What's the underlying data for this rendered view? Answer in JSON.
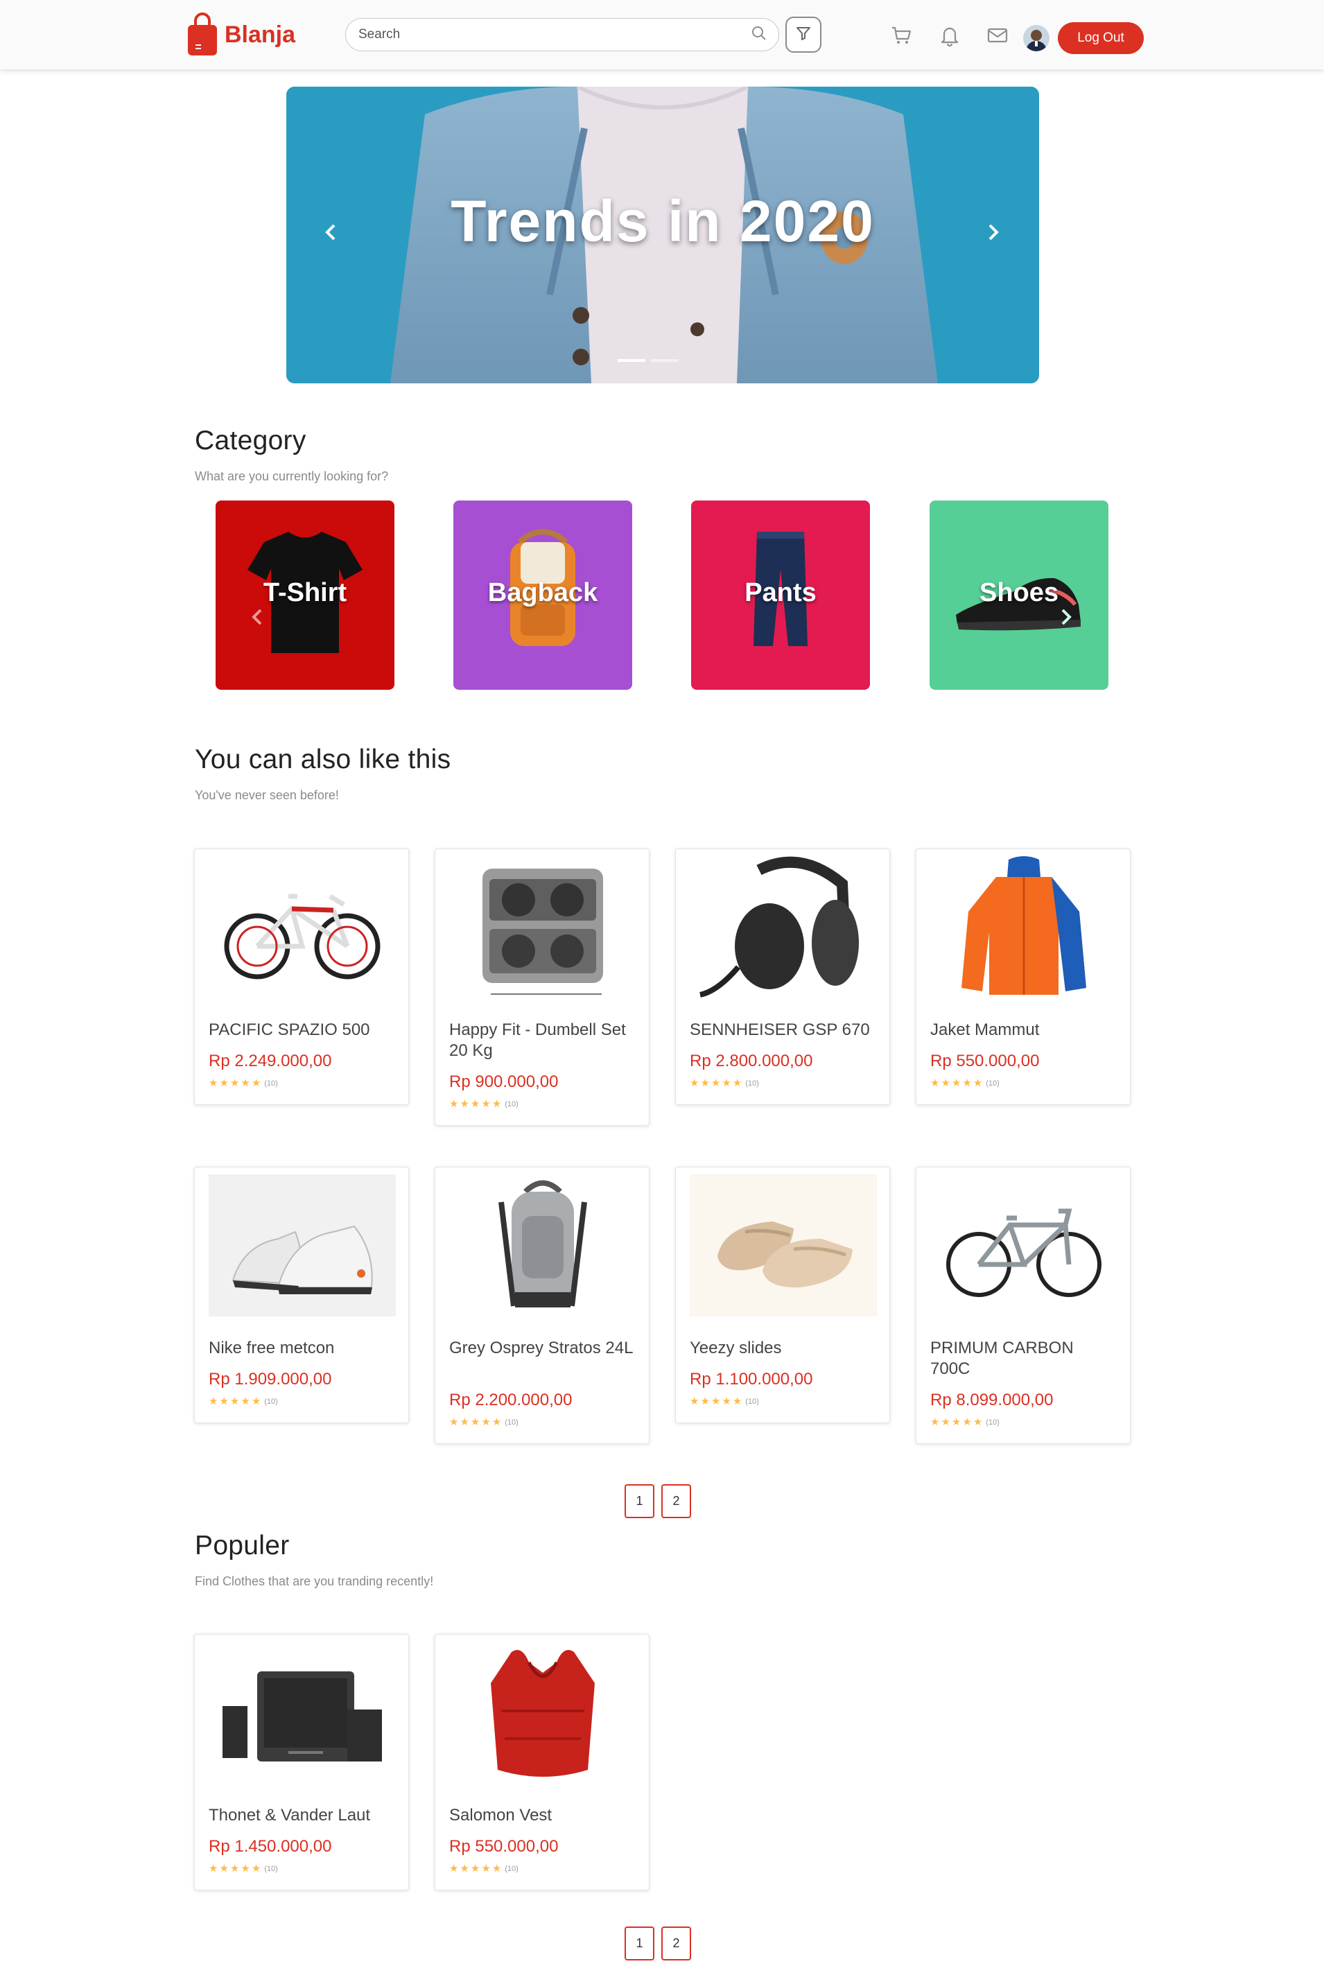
{
  "brand": {
    "name": "Blanja",
    "color": "#db3022"
  },
  "header": {
    "search_placeholder": "Search",
    "logout_label": "Log Out",
    "icons": [
      "search-icon",
      "filter-icon",
      "cart-icon",
      "bell-icon",
      "mail-icon"
    ]
  },
  "hero": {
    "title": "Trends in 2020",
    "slide_count": 2,
    "active_slide": 1
  },
  "category": {
    "title": "Category",
    "subtitle": "What are you currently looking for?",
    "items": [
      {
        "label": "T-Shirt",
        "color": "#cb0a0a"
      },
      {
        "label": "Bagback",
        "color": "#a64fd2"
      },
      {
        "label": "Pants",
        "color": "#e31b50"
      },
      {
        "label": "Shoes",
        "color": "#56cf96"
      }
    ]
  },
  "new": {
    "title": "You can also like this",
    "subtitle": "You've never seen before!",
    "products": [
      {
        "name": "PACIFIC SPAZIO 500",
        "price": "Rp 2.249.000,00",
        "reviews": "(10)"
      },
      {
        "name": "Happy Fit - Dumbell Set 20 Kg",
        "price": "Rp 900.000,00",
        "reviews": "(10)"
      },
      {
        "name": "SENNHEISER GSP 670",
        "price": "Rp 2.800.000,00",
        "reviews": "(10)"
      },
      {
        "name": "Jaket Mammut",
        "price": "Rp 550.000,00",
        "reviews": "(10)"
      },
      {
        "name": "Nike free metcon",
        "price": "Rp 1.909.000,00",
        "reviews": "(10)"
      },
      {
        "name": "Grey Osprey Stratos 24L",
        "price": "Rp 2.200.000,00",
        "reviews": "(10)"
      },
      {
        "name": "Yeezy slides",
        "price": "Rp 1.100.000,00",
        "reviews": "(10)"
      },
      {
        "name": "PRIMUM CARBON 700C",
        "price": "Rp 8.099.000,00",
        "reviews": "(10)"
      }
    ],
    "pages": [
      "1",
      "2"
    ]
  },
  "popular": {
    "title": "Populer",
    "subtitle": "Find Clothes that are you tranding recently!",
    "products": [
      {
        "name": "Thonet & Vander Laut",
        "price": "Rp 1.450.000,00",
        "reviews": "(10)"
      },
      {
        "name": "Salomon Vest",
        "price": "Rp 550.000,00",
        "reviews": "(10)"
      }
    ],
    "pages": [
      "1",
      "2"
    ]
  }
}
